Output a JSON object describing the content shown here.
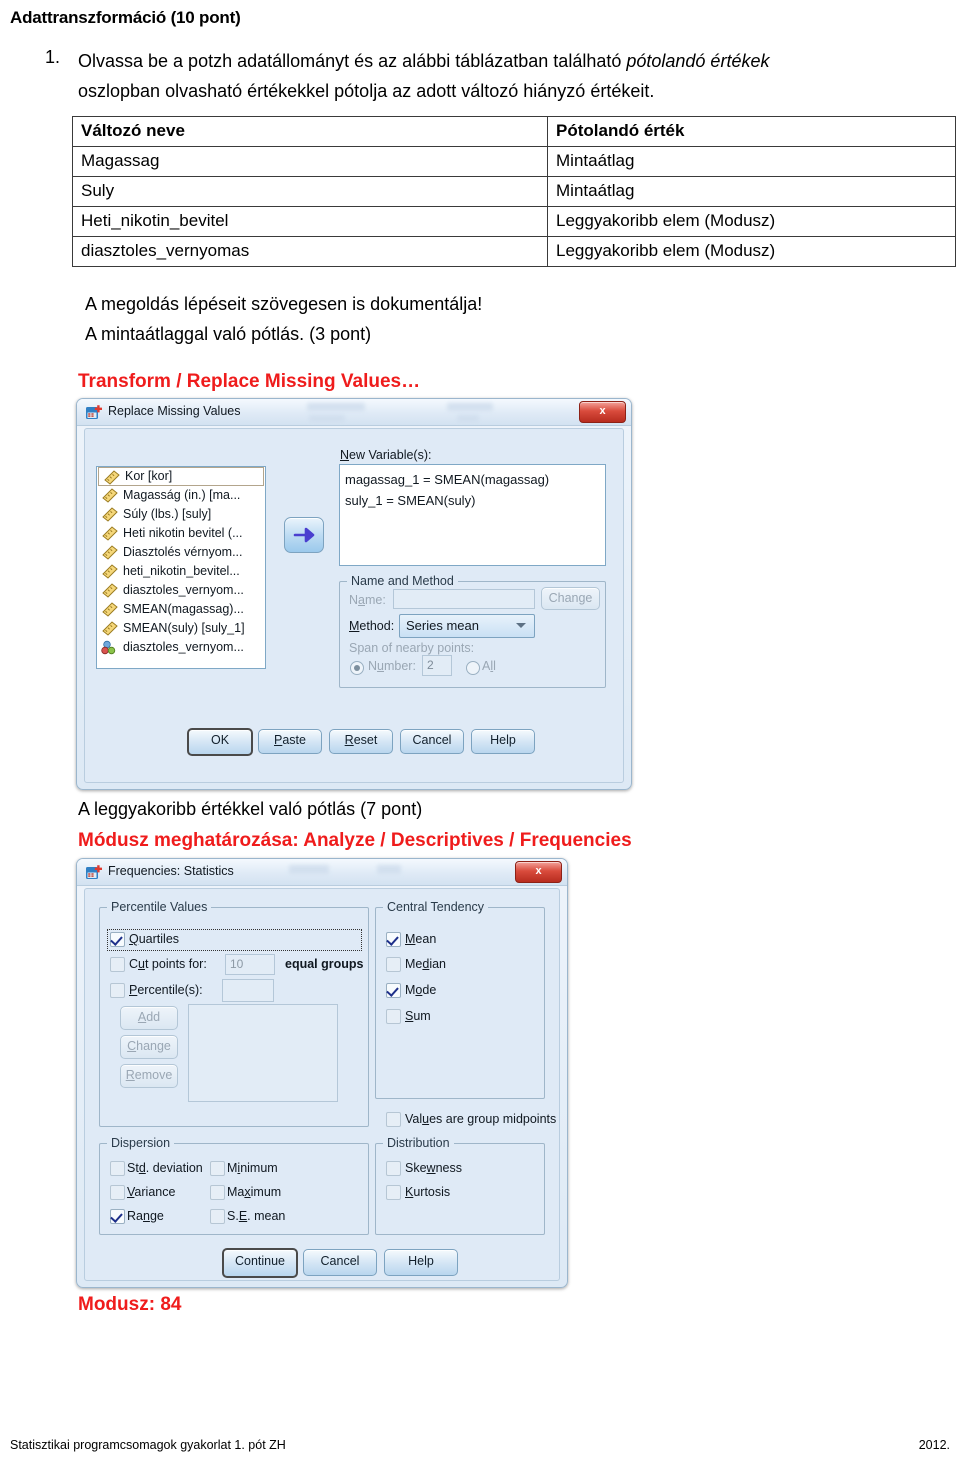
{
  "document": {
    "title": "Adattranszformáció (10 pont)",
    "question_number": "1.",
    "question_text_part1": "Olvassa be a potzh adatállományt és az alábbi táblázatban található ",
    "question_text_italic": "pótolandó értékek",
    "question_text_part2": "oszlopban olvasható értékekkel pótolja az adott változó hiányzó értékeit.",
    "note1": "A megoldás lépéseit szövegesen is dokumentálja!",
    "note2": "A mintaátlaggal való pótlás. (3 pont)",
    "menu_path1": "Transform / Replace Missing Values…",
    "note3": "A leggyakoribb értékkel való pótlás (7 pont)",
    "menu_path2": "Módusz meghatározása: Analyze / Descriptives / Frequencies",
    "result": "Modusz: 84",
    "footer_left": "Statisztikai programcsomagok gyakorlat 1. pót ZH",
    "footer_right": "2012.",
    "accent_color": "#ef1c1c"
  },
  "table": {
    "headers": [
      "Változó neve",
      "Pótolandó érték"
    ],
    "rows": [
      [
        "Magassag",
        "Mintaátlag"
      ],
      [
        "Suly",
        "Mintaátlag"
      ],
      [
        "Heti_nikotin_bevitel",
        "Leggyakoribb elem (Modusz)"
      ],
      [
        "diasztoles_vernyomas",
        "Leggyakoribb elem (Modusz)"
      ]
    ]
  },
  "dialog_replace": {
    "title": "Replace Missing Values",
    "close_label": "x",
    "variable_list": [
      {
        "label": "Kor [kor]",
        "icon": "ruler-icon",
        "selected": true
      },
      {
        "label": "Magasság (in.) [ma...",
        "icon": "ruler-icon",
        "selected": false
      },
      {
        "label": "Súly (lbs.) [suly]",
        "icon": "ruler-icon",
        "selected": false
      },
      {
        "label": "Heti nikotin bevitel (...",
        "icon": "ruler-icon",
        "selected": false
      },
      {
        "label": "Diasztolés vérnyom...",
        "icon": "ruler-icon",
        "selected": false
      },
      {
        "label": "heti_nikotin_bevitel...",
        "icon": "ruler-icon",
        "selected": false
      },
      {
        "label": "diasztoles_vernyom...",
        "icon": "ruler-icon",
        "selected": false
      },
      {
        "label": "SMEAN(magassag)...",
        "icon": "ruler-icon",
        "selected": false
      },
      {
        "label": "SMEAN(suly) [suly_1]",
        "icon": "ruler-icon",
        "selected": false
      },
      {
        "label": "diasztoles_vernyom...",
        "icon": "nominal-icon",
        "selected": false
      }
    ],
    "new_variables_label": "New Variable(s):",
    "new_variables": [
      "magassag_1 = SMEAN(magassag)",
      "suly_1 = SMEAN(suly)"
    ],
    "group_name_method": "Name and Method",
    "name_label": "Name:",
    "name_value": "",
    "change_button": "Change",
    "method_label": "Method:",
    "method_value": "Series mean",
    "span_label": "Span of nearby points:",
    "number_radio_label": "Number:",
    "number_value": "2",
    "all_radio_label": "All",
    "buttons": [
      "OK",
      "Paste",
      "Reset",
      "Cancel",
      "Help"
    ]
  },
  "dialog_frequencies": {
    "title": "Frequencies: Statistics",
    "close_label": "x",
    "percentile_group": "Percentile Values",
    "quartiles_label": "Quartiles",
    "quartiles_checked": true,
    "cutpoints_label": "Cut points for:",
    "cutpoints_checked": false,
    "cutpoints_value": "10",
    "equal_groups_label": "equal groups",
    "percentiles_label": "Percentile(s):",
    "percentiles_checked": false,
    "percentiles_value": "",
    "add_button": "Add",
    "change_button": "Change",
    "remove_button": "Remove",
    "central_group": "Central Tendency",
    "central_items": [
      {
        "label": "Mean",
        "checked": true
      },
      {
        "label": "Median",
        "checked": false
      },
      {
        "label": "Mode",
        "checked": true
      },
      {
        "label": "Sum",
        "checked": false
      }
    ],
    "midpoints_label": "Values are group midpoints",
    "midpoints_checked": false,
    "dispersion_group": "Dispersion",
    "dispersion_left": [
      {
        "label": "Std. deviation",
        "checked": false
      },
      {
        "label": "Variance",
        "checked": false
      },
      {
        "label": "Range",
        "checked": true
      }
    ],
    "dispersion_right": [
      {
        "label": "Minimum",
        "checked": false
      },
      {
        "label": "Maximum",
        "checked": false
      },
      {
        "label": "S.E. mean",
        "checked": false
      }
    ],
    "distribution_group": "Distribution",
    "distribution_items": [
      {
        "label": "Skewness",
        "checked": false
      },
      {
        "label": "Kurtosis",
        "checked": false
      }
    ],
    "buttons": [
      "Continue",
      "Cancel",
      "Help"
    ]
  }
}
